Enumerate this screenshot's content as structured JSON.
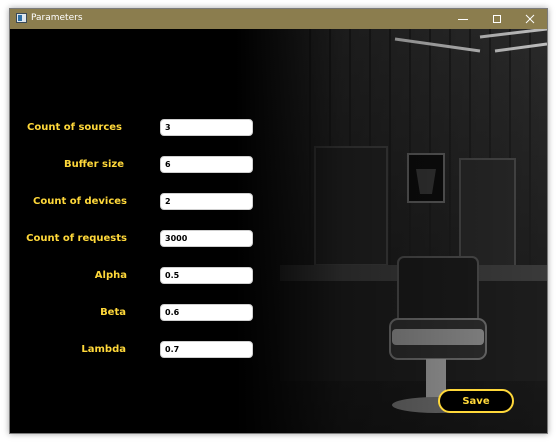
{
  "window": {
    "title": "Parameters",
    "icon": "app-window-icon",
    "controls": [
      "minimize-icon",
      "maximize-icon",
      "close-icon"
    ],
    "titlebar_color": "#8b7d4e"
  },
  "form": {
    "fields": [
      {
        "label": "Count of sources",
        "value": "3"
      },
      {
        "label": "Buffer size",
        "value": "6"
      },
      {
        "label": "Count of devices",
        "value": "2"
      },
      {
        "label": "Count of requests",
        "value": "3000"
      },
      {
        "label": "Alpha",
        "value": "0.5"
      },
      {
        "label": "Beta",
        "value": "0.6"
      },
      {
        "label": "Lambda",
        "value": "0.7"
      }
    ],
    "save_label": "Save",
    "accent_color": "#ffd83a"
  }
}
